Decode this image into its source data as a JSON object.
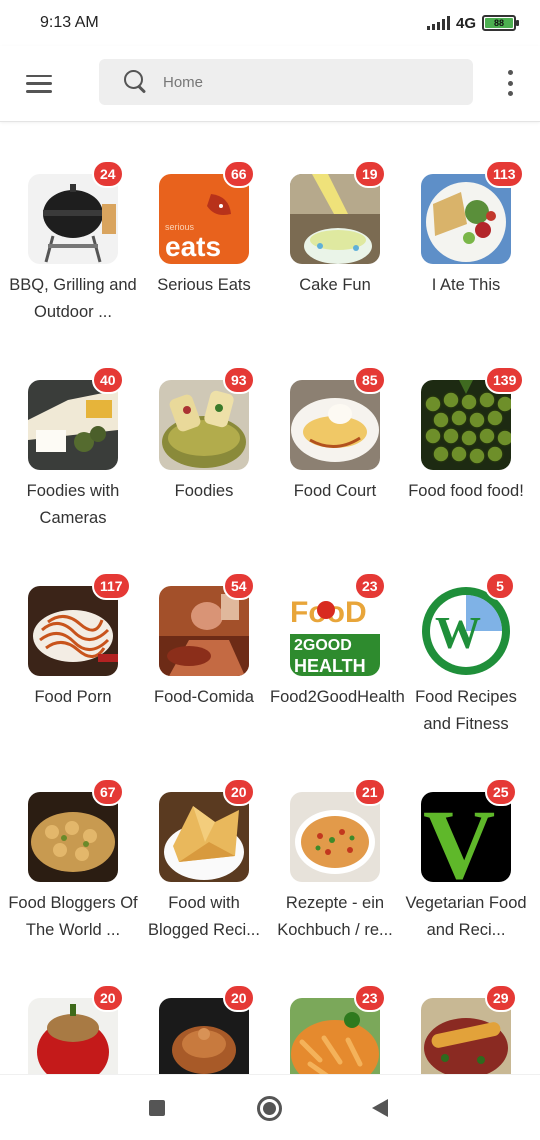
{
  "status_bar": {
    "time": "9:13 AM",
    "network": "4G",
    "battery": "88"
  },
  "search": {
    "placeholder": "Home"
  },
  "colors": {
    "badge": "#e53935",
    "search_bg": "#eeeeee"
  },
  "icons": {
    "menu": "hamburger-menu-icon",
    "search": "search-icon",
    "more": "more-vert-icon",
    "nav_recent": "square-icon",
    "nav_home": "circle-icon",
    "nav_back": "triangle-back-icon"
  },
  "feeds": [
    {
      "label": "BBQ, Grilling and Outdoor ...",
      "count": "24"
    },
    {
      "label": "Serious Eats",
      "count": "66",
      "logo_text": "eats",
      "logo_small": "serious"
    },
    {
      "label": "Cake Fun",
      "count": "19"
    },
    {
      "label": "I Ate This",
      "count": "113"
    },
    {
      "label": "Foodies with Cameras",
      "count": "40"
    },
    {
      "label": "Foodies",
      "count": "93"
    },
    {
      "label": "Food Court",
      "count": "85"
    },
    {
      "label": "Food food food!",
      "count": "139"
    },
    {
      "label": "Food Porn",
      "count": "117"
    },
    {
      "label": "Food-Comida",
      "count": "54"
    },
    {
      "label": "Food2GoodHealth",
      "count": "23",
      "logo_top": "FooD",
      "logo_mid": "2GOOD",
      "logo_bot": "HEALTH"
    },
    {
      "label": "Food Recipes and Fitness",
      "count": "5",
      "logo_text": "W"
    },
    {
      "label": "Food Bloggers Of The World ...",
      "count": "67"
    },
    {
      "label": "Food with Blogged Reci...",
      "count": "20"
    },
    {
      "label": "Rezepte - ein Kochbuch / re...",
      "count": "21"
    },
    {
      "label": "Vegetarian Food and Reci...",
      "count": "25",
      "logo_text": "V"
    },
    {
      "label": "",
      "count": "20"
    },
    {
      "label": "",
      "count": "20"
    },
    {
      "label": "",
      "count": "23"
    },
    {
      "label": "",
      "count": "29"
    }
  ]
}
